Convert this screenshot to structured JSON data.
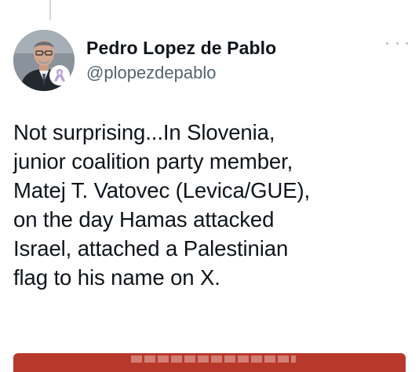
{
  "author": {
    "display_name": "Pedro Lopez de Pablo",
    "handle": "@plopezdepablo",
    "avatar_icon": "person-avatar",
    "badge_icon": "awareness-ribbon-icon",
    "badge_color": "#b6a0d6"
  },
  "more_icon": "more-horizontal-icon",
  "tweet": {
    "lines": [
      "Not surprising...In Slovenia,",
      "junior coalition party member,",
      "Matej T. Vatovec (Levica/GUE),",
      "on the day Hamas attacked",
      "Israel, attached a Palestinian",
      "flag to his name on X."
    ]
  },
  "colors": {
    "text_primary": "#0f1419",
    "text_secondary": "#536471",
    "thread_line": "#cfd9de",
    "banner": "#b8392c"
  }
}
